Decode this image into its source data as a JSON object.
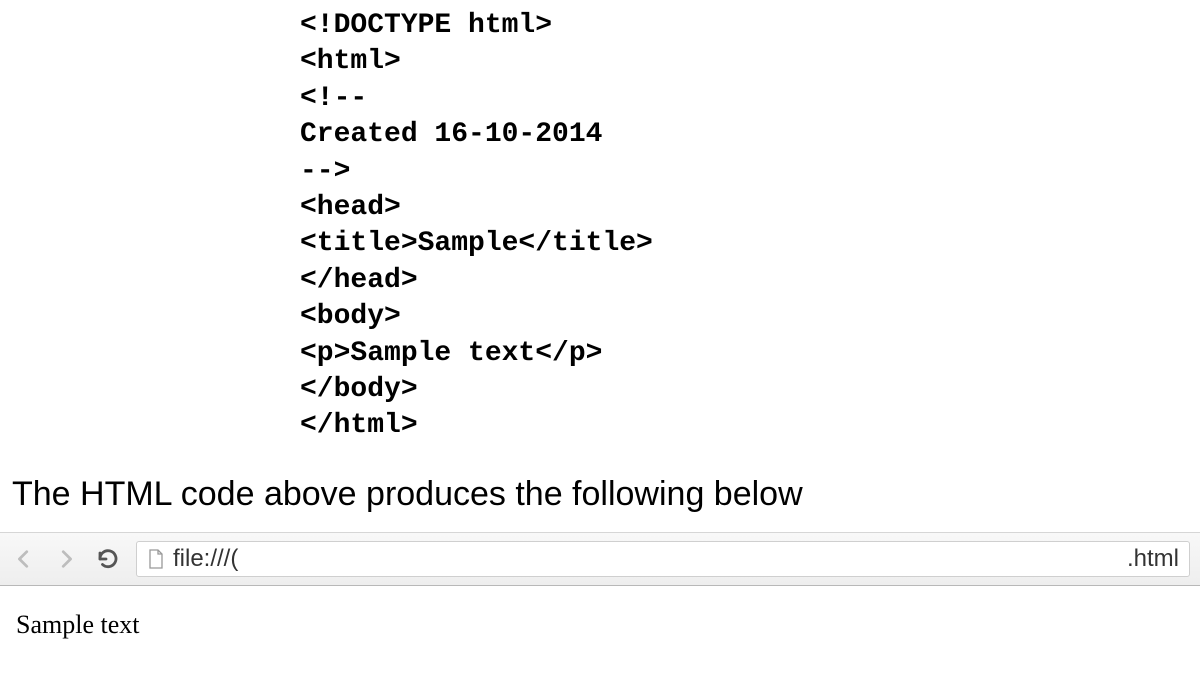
{
  "code": {
    "line1": "<!DOCTYPE html>",
    "line2": "<html>",
    "line3": "<!--",
    "line4": "Created 16-10-2014",
    "line5": "-->",
    "line6": "<head>",
    "line7": "<title>Sample</title>",
    "line8": "</head>",
    "line9": "<body>",
    "line10": "<p>Sample text</p>",
    "line11": "</body>",
    "line12": "</html>"
  },
  "caption": "The HTML code above produces the following below",
  "browser": {
    "url_prefix": "file:///(",
    "url_suffix": ".html"
  },
  "output": {
    "paragraph": "Sample text"
  }
}
